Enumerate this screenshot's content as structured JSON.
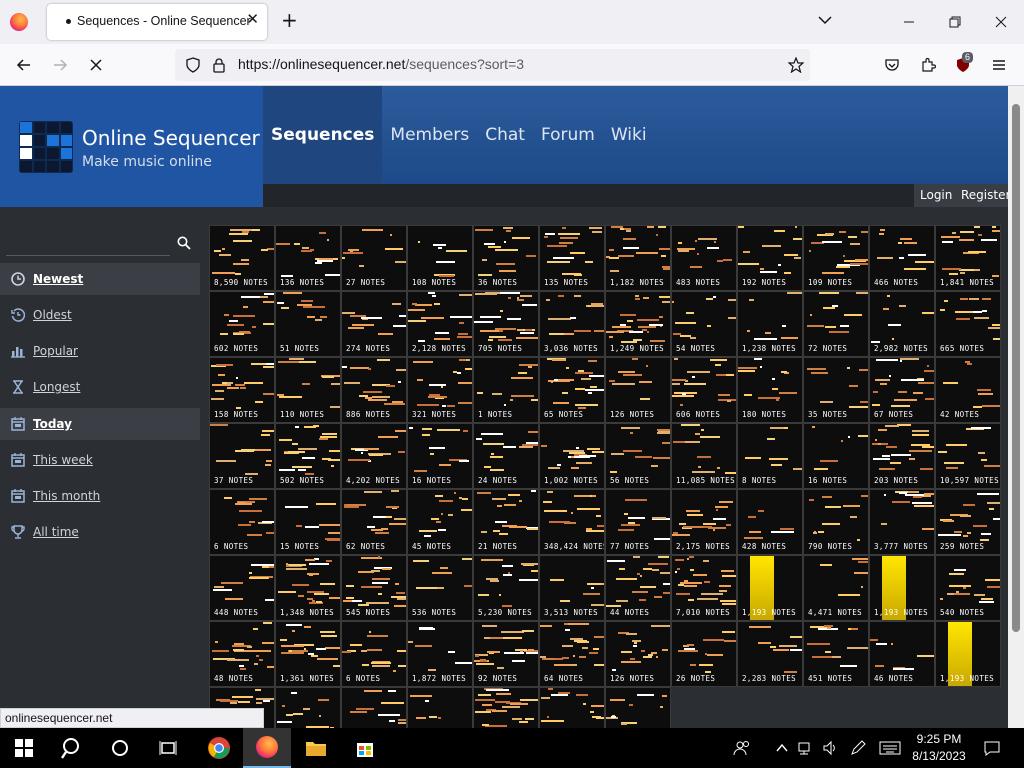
{
  "browser": {
    "tab_title": "Sequences - Online Sequencer",
    "url_host": "https://onlinesequencer.net",
    "url_path": "/sequences?sort=3",
    "ublock_count": "6",
    "status_url": "onlinesequencer.net"
  },
  "site": {
    "title": "Online Sequencer",
    "tagline": "Make music online",
    "nav": [
      "Sequences",
      "Members",
      "Chat",
      "Forum",
      "Wiki"
    ],
    "login": "Login",
    "register": "Register"
  },
  "sidebar": {
    "search_placeholder": "",
    "items": [
      {
        "label": "Newest",
        "icon": "clock-icon",
        "active": true
      },
      {
        "label": "Oldest",
        "icon": "history-icon",
        "active": false
      },
      {
        "label": "Popular",
        "icon": "bar-chart-icon",
        "active": false
      },
      {
        "label": "Longest",
        "icon": "hourglass-icon",
        "active": false
      },
      {
        "label": "Today",
        "icon": "calendar-icon",
        "active": true
      },
      {
        "label": "This week",
        "icon": "calendar-icon",
        "active": false
      },
      {
        "label": "This month",
        "icon": "calendar-icon",
        "active": false
      },
      {
        "label": "All time",
        "icon": "trophy-icon",
        "active": false
      }
    ]
  },
  "sequences": [
    [
      "8,590 NOTES",
      "136 NOTES",
      "27 NOTES",
      "108 NOTES",
      "36 NOTES",
      "135 NOTES",
      "1,182 NOTES",
      "483 NOTES",
      "192 NOTES",
      "109 NOTES",
      "466 NOTES",
      "1,841 NOTES"
    ],
    [
      "602 NOTES",
      "51 NOTES",
      "274 NOTES",
      "2,128 NOTES",
      "705 NOTES",
      "3,036 NOTES",
      "1,249 NOTES",
      "54 NOTES",
      "1,238 NOTES",
      "72 NOTES",
      "2,982 NOTES",
      "665 NOTES"
    ],
    [
      "158 NOTES",
      "110 NOTES",
      "886 NOTES",
      "321 NOTES",
      "1 NOTES",
      "65 NOTES",
      "126 NOTES",
      "606 NOTES",
      "180 NOTES",
      "35 NOTES",
      "67 NOTES",
      "42 NOTES"
    ],
    [
      "37 NOTES",
      "502 NOTES",
      "4,202 NOTES",
      "16 NOTES",
      "24 NOTES",
      "1,002 NOTES",
      "56 NOTES",
      "11,085 NOTES",
      "8 NOTES",
      "16 NOTES",
      "203 NOTES",
      "10,597 NOTES"
    ],
    [
      "6 NOTES",
      "15 NOTES",
      "62 NOTES",
      "45 NOTES",
      "21 NOTES",
      "348,424 NOTES",
      "77 NOTES",
      "2,175 NOTES",
      "428 NOTES",
      "790 NOTES",
      "3,777 NOTES",
      "259 NOTES"
    ],
    [
      "448 NOTES",
      "1,348 NOTES",
      "545 NOTES",
      "536 NOTES",
      "5,230 NOTES",
      "3,513 NOTES",
      "44 NOTES",
      "7,010 NOTES",
      "1,193 NOTES",
      "4,471 NOTES",
      "1,193 NOTES",
      "540 NOTES"
    ],
    [
      "48 NOTES",
      "1,361 NOTES",
      "6 NOTES",
      "1,872 NOTES",
      "92 NOTES",
      "64 NOTES",
      "126 NOTES",
      "26 NOTES",
      "2,283 NOTES",
      "451 NOTES",
      "46 NOTES",
      "1,193 NOTES"
    ],
    [
      "",
      "",
      "",
      "",
      "",
      "",
      ""
    ]
  ],
  "gold_cells": [
    [
      5,
      8
    ],
    [
      5,
      10
    ],
    [
      6,
      11
    ]
  ],
  "taskbar": {
    "time": "9:25 PM",
    "date": "8/13/2023"
  }
}
